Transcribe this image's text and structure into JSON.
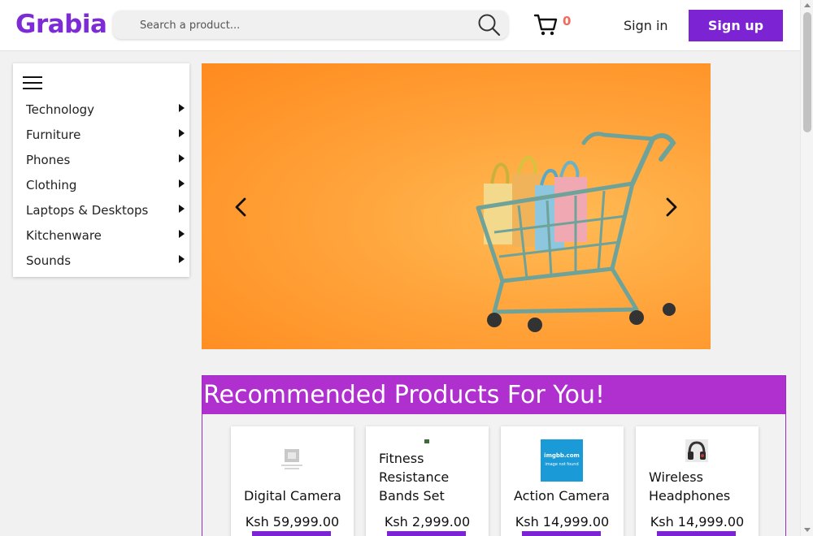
{
  "header": {
    "logo": "Grabia",
    "search_placeholder": "Search a product...",
    "cart_count": "0",
    "signin_label": "Sign in",
    "signup_label": "Sign up"
  },
  "sidebar": {
    "categories": [
      {
        "label": "Technology"
      },
      {
        "label": "Furniture"
      },
      {
        "label": "Phones"
      },
      {
        "label": "Clothing"
      },
      {
        "label": "Laptops & Desktops"
      },
      {
        "label": "Kitchenware"
      },
      {
        "label": "Sounds"
      }
    ]
  },
  "recommended": {
    "title": "Recommended Products For You!",
    "products": [
      {
        "name": "Digital Camera",
        "price": "Ksh 59,999.00"
      },
      {
        "name": "Fitness Resistance Bands Set",
        "price": "Ksh 2,999.00"
      },
      {
        "name": "Action Camera",
        "price": "Ksh 14,999.00",
        "thumb_line1": "imgbb.com",
        "thumb_line2": "image not found"
      },
      {
        "name": "Wireless Headphones",
        "price": "Ksh 14,999.00"
      }
    ]
  },
  "colors": {
    "brand": "#7d2bd6",
    "accent_button": "#7c24d3",
    "section_header": "#b02fcf",
    "cart_count": "#f26a5b"
  }
}
